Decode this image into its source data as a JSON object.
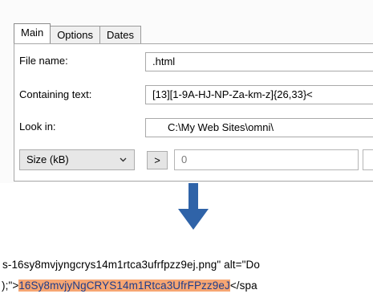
{
  "tabs": [
    {
      "label": "Main",
      "active": true
    },
    {
      "label": "Options",
      "active": false
    },
    {
      "label": "Dates",
      "active": false
    }
  ],
  "form": {
    "file_name_label": "File name:",
    "file_name_value": ".html",
    "containing_text_label": "Containing text:",
    "containing_text_value": "[13][1-9A-HJ-NP-Za-km-z]{26,33}<",
    "look_in_label": "Look in:",
    "look_in_value": "C:\\My Web Sites\\omni\\",
    "size_select_value": "Size (kB)",
    "operator_value": ">",
    "size_value": "0"
  },
  "arrow_icon": "arrow-down-icon",
  "result": {
    "line1": "s-16sy8mvjyngcrys14m1rtca3ufrfpzz9ej.png\" alt=\"Do",
    "line2_prefix": ");\">",
    "line2_highlight": "16Sy8mvjyNgCRYS14m1Rtca3UfrFPzz9eJ",
    "line2_suffix": "</spa"
  },
  "colors": {
    "arrow": "#2f63a8",
    "highlight_bg": "#f6a673",
    "highlight_text": "#1f3c8a"
  }
}
